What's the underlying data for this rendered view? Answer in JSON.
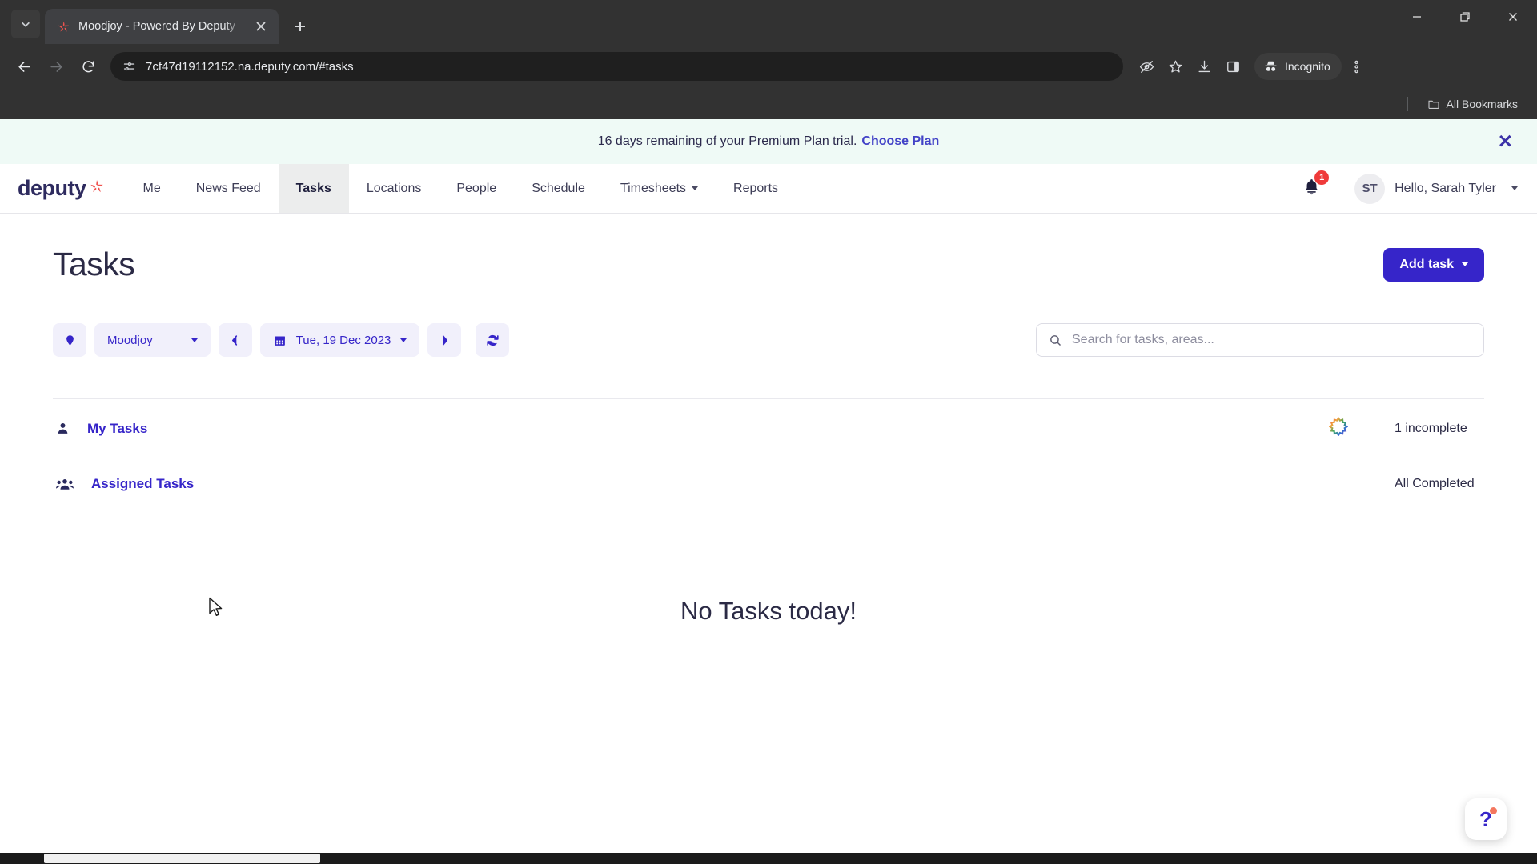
{
  "browser": {
    "tab": {
      "title": "Moodjoy - Powered By Deputy",
      "favicon_icon": "deputy-star-icon",
      "close_icon": "close-icon"
    },
    "tab_list_icon": "chevron-down-icon",
    "new_tab_icon": "plus-icon",
    "window_controls": {
      "minimize_icon": "minimize-icon",
      "maximize_icon": "restore-icon",
      "close_icon": "close-icon"
    },
    "nav": {
      "back_icon": "arrow-left-icon",
      "forward_icon": "arrow-right-icon",
      "reload_icon": "reload-icon"
    },
    "omnibox": {
      "url": "7cf47d19112152.na.deputy.com/#tasks",
      "site_info_icon": "page-info-icon"
    },
    "toolbar_icons": [
      {
        "name": "hide-password-icon"
      },
      {
        "name": "bookmark-star-icon"
      },
      {
        "name": "downloads-icon"
      },
      {
        "name": "side-panel-icon"
      }
    ],
    "incognito": {
      "label": "Incognito",
      "icon": "incognito-icon"
    },
    "menu_icon": "three-dot-menu-icon",
    "bookmarks_bar": {
      "label": "All Bookmarks",
      "icon": "folder-icon"
    }
  },
  "banner": {
    "message": "16 days remaining of your Premium Plan trial.",
    "cta": "Choose Plan",
    "close_icon": "close-icon",
    "background": "#effaf6"
  },
  "navbar": {
    "logo_text": "deputy",
    "logo_icon": "deputy-star-icon",
    "items": [
      {
        "label": "Me",
        "active": false,
        "has_caret": false
      },
      {
        "label": "News Feed",
        "active": false,
        "has_caret": false
      },
      {
        "label": "Tasks",
        "active": true,
        "has_caret": false
      },
      {
        "label": "Locations",
        "active": false,
        "has_caret": false
      },
      {
        "label": "People",
        "active": false,
        "has_caret": false
      },
      {
        "label": "Schedule",
        "active": false,
        "has_caret": false
      },
      {
        "label": "Timesheets",
        "active": false,
        "has_caret": true
      },
      {
        "label": "Reports",
        "active": false,
        "has_caret": false
      }
    ],
    "notifications": {
      "icon": "bell-icon",
      "count": "1",
      "badge_color": "#ef3a3a"
    },
    "user": {
      "initials": "ST",
      "greeting": "Hello, Sarah Tyler",
      "caret_icon": "chevron-down-icon"
    }
  },
  "page": {
    "title": "Tasks",
    "add_task": {
      "label": "Add task",
      "caret_icon": "chevron-down-icon",
      "color": "#3625c9"
    }
  },
  "filters": {
    "location_pin_icon": "location-pin-icon",
    "location": {
      "value": "Moodjoy",
      "caret_icon": "chevron-down-icon"
    },
    "prev_icon": "chevron-left-icon",
    "next_icon": "chevron-right-icon",
    "date": {
      "value": "Tue, 19 Dec 2023",
      "calendar_icon": "calendar-icon",
      "caret_icon": "chevron-down-icon"
    },
    "refresh_icon": "refresh-icon"
  },
  "search": {
    "placeholder": "Search for tasks, areas...",
    "value": "",
    "icon": "search-icon"
  },
  "task_sections": [
    {
      "label": "My Tasks",
      "icon": "user-icon",
      "status": "1 incomplete",
      "spinner_icon": "loading-spinner-icon",
      "has_spinner": true
    },
    {
      "label": "Assigned Tasks",
      "icon": "users-icon",
      "status": "All Completed",
      "has_spinner": false
    }
  ],
  "empty_state": {
    "message": "No Tasks today!"
  },
  "help": {
    "icon": "question-mark-icon",
    "has_notification_dot": true
  }
}
